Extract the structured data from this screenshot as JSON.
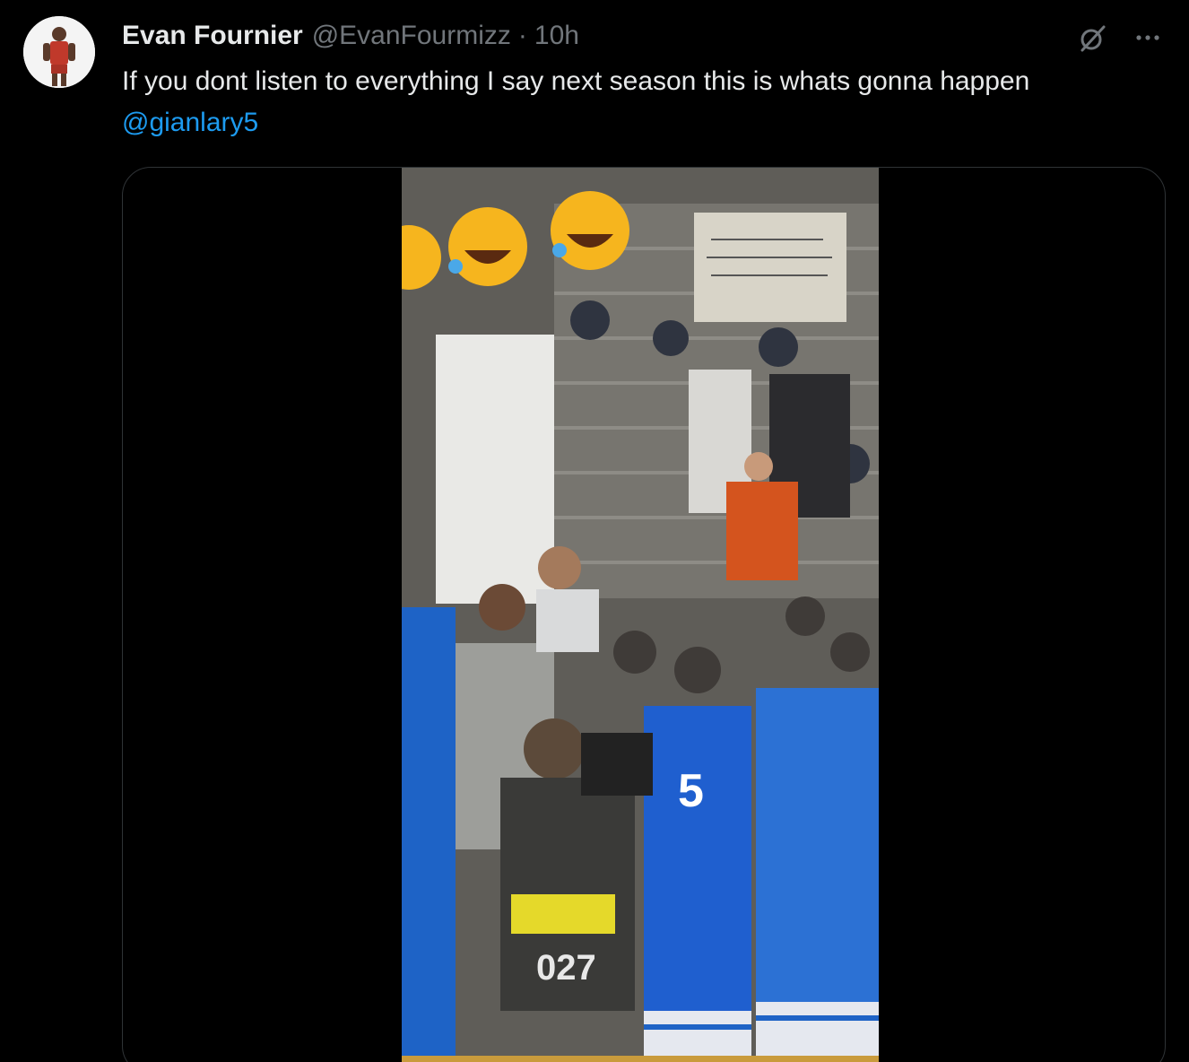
{
  "author": {
    "name": "Evan Fournier",
    "handle": "@EvanFourmizz",
    "separator": "·",
    "time": "10h"
  },
  "tweet": {
    "text": "If you dont listen to everything I say next season this is whats gonna happen",
    "mention": "@gianlary5"
  },
  "media": {
    "kind": "video"
  },
  "colors": {
    "background": "#000000",
    "text": "#e7e9ea",
    "secondary": "#71767b",
    "link": "#1d9bf0",
    "border": "#2f3336"
  },
  "icons": {
    "grok": "grok-icon",
    "more": "more-icon"
  }
}
